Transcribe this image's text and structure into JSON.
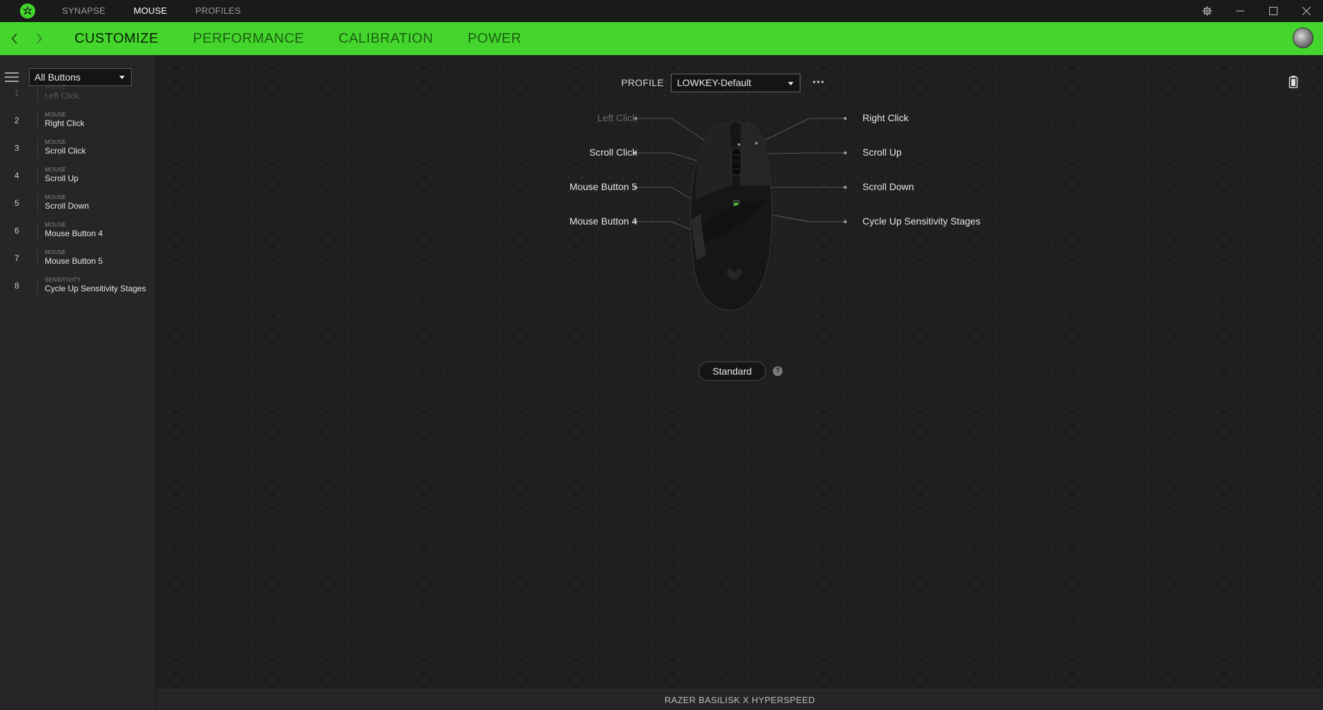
{
  "titlebar": {
    "tabs": [
      {
        "label": "SYNAPSE",
        "active": false
      },
      {
        "label": "MOUSE",
        "active": true
      },
      {
        "label": "PROFILES",
        "active": false
      }
    ],
    "icons": [
      "razer-logo-icon",
      "settings-gear-icon",
      "minimize-icon",
      "maximize-icon",
      "close-icon"
    ]
  },
  "nav": {
    "tabs": [
      {
        "label": "CUSTOMIZE",
        "active": true
      },
      {
        "label": "PERFORMANCE",
        "active": false
      },
      {
        "label": "CALIBRATION",
        "active": false
      },
      {
        "label": "POWER",
        "active": false
      }
    ],
    "accent_color": "#44d62c"
  },
  "sidebar": {
    "filter_value": "All Buttons",
    "buttons": [
      {
        "num": "1",
        "category": "MOUSE",
        "name": "Left Click",
        "dim": true
      },
      {
        "num": "2",
        "category": "MOUSE",
        "name": "Right Click",
        "dim": false
      },
      {
        "num": "3",
        "category": "MOUSE",
        "name": "Scroll Click",
        "dim": false
      },
      {
        "num": "4",
        "category": "MOUSE",
        "name": "Scroll Up",
        "dim": false
      },
      {
        "num": "5",
        "category": "MOUSE",
        "name": "Scroll Down",
        "dim": false
      },
      {
        "num": "6",
        "category": "MOUSE",
        "name": "Mouse Button 4",
        "dim": false
      },
      {
        "num": "7",
        "category": "MOUSE",
        "name": "Mouse Button 5",
        "dim": false
      },
      {
        "num": "8",
        "category": "SENSITIVITY",
        "name": "Cycle Up Sensitivity Stages",
        "dim": false
      }
    ]
  },
  "main": {
    "profile_label": "PROFILE",
    "profile_value": "LOWKEY-Default",
    "mouse_labels": {
      "left": [
        "Left Click",
        "Scroll Click",
        "Mouse Button 5",
        "Mouse Button 4"
      ],
      "right": [
        "Right Click",
        "Scroll Up",
        "Scroll Down",
        "Cycle Up Sensitivity Stages"
      ]
    },
    "mode_button": "Standard",
    "help_glyph": "?"
  },
  "footer": {
    "device_name": "RAZER BASILISK X HYPERSPEED"
  }
}
